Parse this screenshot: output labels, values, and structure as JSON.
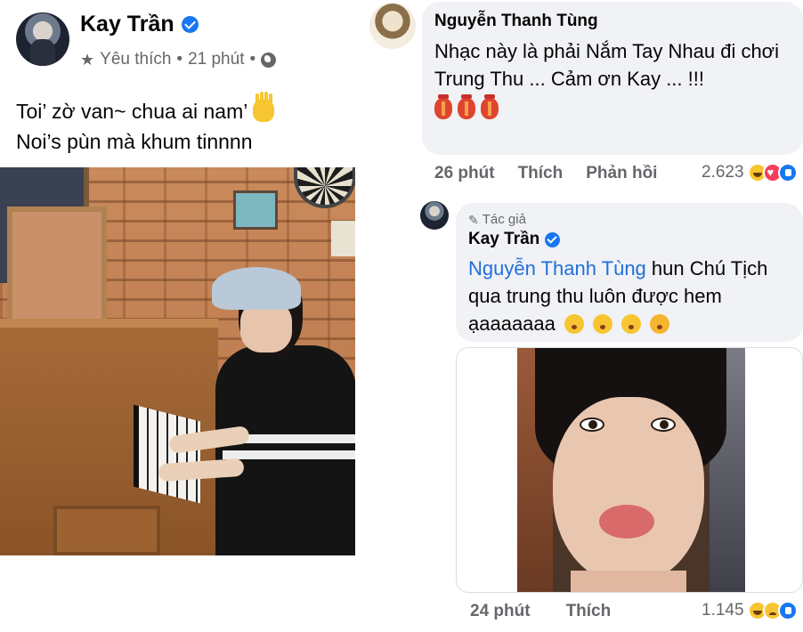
{
  "post": {
    "author": "Kay Trần",
    "audience_label": "Yêu thích",
    "separator": "•",
    "time": "21 phút",
    "text_line1": "Toi’ zờ van~ chua ai nam’",
    "text_line2": "Noi’s pùn mà khum tinnnn",
    "icons": [
      "star-icon",
      "globe-icon",
      "verified-badge-icon",
      "waving-hand-emoji"
    ]
  },
  "comment1": {
    "author": "Nguyễn Thanh Tùng",
    "text": "Nhạc này là phải Nắm Tay Nhau đi chơi Trung Thu ... Cảm ơn Kay ... !!!",
    "emoji": [
      "lantern-icon",
      "lantern-icon",
      "lantern-icon"
    ],
    "time": "26 phút",
    "like_label": "Thích",
    "reply_label": "Phản hồi",
    "reaction_count": "2.623",
    "reactions": [
      "haha",
      "love",
      "like"
    ]
  },
  "comment2": {
    "author_badge": "Tác giả",
    "author": "Kay Trần",
    "mention": "Nguyễn Thanh Tùng",
    "text_line1": " hun Chú Tịch",
    "text_line2": "qua trung thu luôn được hem",
    "text_line3": "ạaaaaaaa",
    "emoji": [
      "kiss-face",
      "kiss-face",
      "kiss-face",
      "kiss-heart-face"
    ],
    "time": "24 phút",
    "like_label": "Thích",
    "reaction_count": "1.145",
    "reactions": [
      "haha",
      "sad",
      "like"
    ]
  },
  "colors": {
    "link_blue": "#216fdb",
    "verified_blue": "#1877f2",
    "meta_gray": "#65676b",
    "bubble_bg": "#f0f2f5"
  }
}
